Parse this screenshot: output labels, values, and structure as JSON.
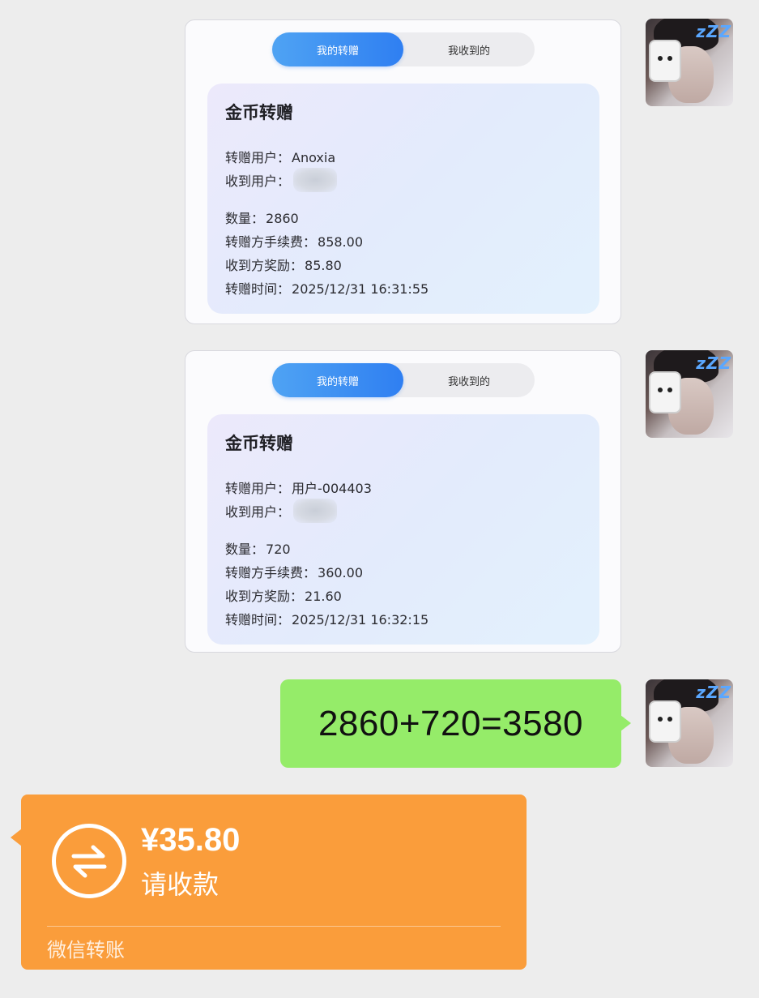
{
  "chat": {
    "gift_cards": [
      {
        "tabs": {
          "mine": "我的转赠",
          "received": "我收到的"
        },
        "title": "金币转赠",
        "giver_label": "转赠用户：",
        "giver_value": "Anoxia",
        "receiver_label": "收到用户：",
        "amount_label": "数量：",
        "amount_value": "2860",
        "fee_label": "转赠方手续费：",
        "fee_value": "858.00",
        "reward_label": "收到方奖励：",
        "reward_value": "85.80",
        "time_label": "转赠时间：",
        "time_value": "2025/12/31 16:31:55"
      },
      {
        "tabs": {
          "mine": "我的转赠",
          "received": "我收到的"
        },
        "title": "金币转赠",
        "giver_label": "转赠用户：",
        "giver_value": "用户-004403",
        "receiver_label": "收到用户：",
        "amount_label": "数量：",
        "amount_value": "720",
        "fee_label": "转赠方手续费：",
        "fee_value": "360.00",
        "reward_label": "收到方奖励：",
        "reward_value": "21.60",
        "time_label": "转赠时间：",
        "time_value": "2025/12/31 16:32:15"
      }
    ],
    "text_message": "2860+720=3580",
    "transfer": {
      "amount": "¥35.80",
      "note": "请收款",
      "footer": "微信转账"
    }
  },
  "colors": {
    "background": "#ededed",
    "bubble_green": "#95ec69",
    "transfer_orange": "#fa9d3b",
    "tab_active_blue": "#2f7ff2"
  },
  "icons": [
    "avatar",
    "transfer-arrows-icon"
  ]
}
